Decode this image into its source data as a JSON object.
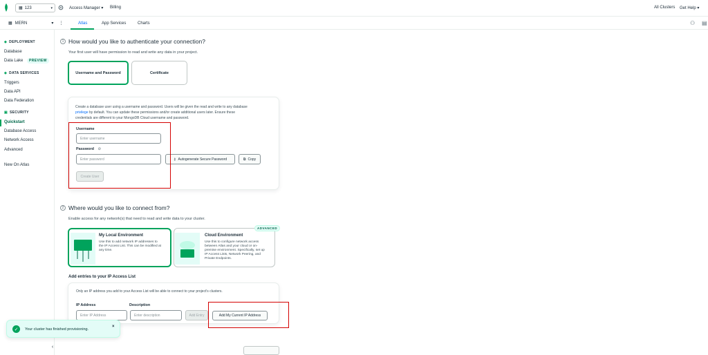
{
  "topbar": {
    "org": "123",
    "project_menu": "Access Manager",
    "billing": "Billing",
    "all_clusters": "All Clusters",
    "get_help": "Get Help"
  },
  "subbar": {
    "project": "MERN",
    "tabs": [
      {
        "label": "Atlas"
      },
      {
        "label": "App Services"
      },
      {
        "label": "Charts"
      }
    ]
  },
  "sidebar": {
    "deployment_heading": "DEPLOYMENT",
    "database": "Database",
    "data_lake": "Data Lake",
    "preview": "PREVIEW",
    "data_services_heading": "DATA SERVICES",
    "triggers": "Triggers",
    "data_api": "Data API",
    "data_federation": "Data Federation",
    "security_heading": "SECURITY",
    "quickstart": "Quickstart",
    "database_access": "Database Access",
    "network_access": "Network Access",
    "advanced": "Advanced",
    "new_on_atlas": "New On Atlas"
  },
  "step1": {
    "num": "1",
    "title": "How would you like to authenticate your connection?",
    "desc": "Your first user will have permission to read and write any data in your project.",
    "choice_userpass": "Username and Password",
    "choice_cert": "Certificate",
    "card_text_1": "Create a database user using a username and password. Users will be given the read and write to any database",
    "card_link": "privilege",
    "card_text_2": " by default. You can update these permissions and/or create additional users later. Ensure these",
    "card_text_3": "credentials are different to your MongoDB Cloud username and password.",
    "username_label": "Username",
    "username_placeholder": "Enter username",
    "password_label": "Password",
    "password_placeholder": "Enter password",
    "autogenerate": "Autogenerate Secure Password",
    "copy": "Copy",
    "create_user": "Create User"
  },
  "step2": {
    "num": "2",
    "title": "Where would you like to connect from?",
    "desc": "Enable access for any network(s) that need to read and write data to your cluster.",
    "local_title": "My Local Environment",
    "local_text": [
      "Use this to add network IP addresses to",
      "the IP Access List. This can be modified at",
      "any time."
    ],
    "cloud_title": "Cloud Environment",
    "cloud_text": [
      "Use this to configure network access",
      "between Atlas and your cloud or on-",
      "premise environment. Specifically, set up",
      "IP Access Lists, Network Peering, and",
      "Private Endpoints."
    ],
    "advanced_badge": "ADVANCED",
    "ip_heading": "Add entries to your IP Access List",
    "ip_note": "Only an IP address you add to your Access List will be able to connect to your project's clusters.",
    "ip_label": "IP Address",
    "ip_placeholder": "Enter IP Address",
    "desc_label": "Description",
    "desc_placeholder": "Enter description",
    "add_entry": "Add Entry",
    "add_current_ip": "Add My Current IP Address"
  },
  "toast": {
    "text": "Your cluster has finished provisioning."
  },
  "colors": {
    "brand_green": "#00a35c",
    "link_blue": "#016bf8",
    "highlight_red": "#d40000"
  }
}
